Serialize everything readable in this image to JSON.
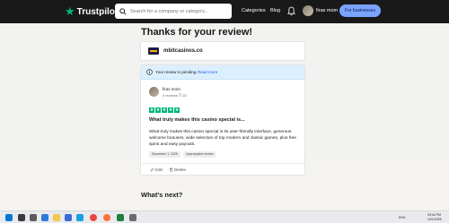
{
  "header": {
    "logo_text": "Trustpilot",
    "search_placeholder": "Search for a company or category...",
    "nav_categories": "Categories",
    "nav_blog": "Blog",
    "user_name": "firas mom",
    "business_button": "For businesses"
  },
  "main": {
    "page_title": "Thanks for your review!",
    "company_name": "mbitcasinos.co",
    "pending_text": "Your review is pending.",
    "read_more": "Read more",
    "reviewer_name": "firas mom",
    "review_count": "0 reviews",
    "country": "JO",
    "rating": 5,
    "review_title": "What truly makes this casino special is...",
    "review_body": "What truly makes this casino special is its user-friendly interface, generous welcome bonuses, wide selection of top modern and classic games, plus free spins and easy payouts.",
    "review_date": "December 1, 2025",
    "unprompted_badge": "Unprompted review",
    "edit_label": "Edit",
    "delete_label": "Delete",
    "whats_next": "What's next?"
  },
  "taskbar": {
    "lang": "ENG",
    "time": "03:44 PM",
    "date": "12/1/2025"
  },
  "colors": {
    "header_bg": "#191919",
    "brand_green": "#00b67a",
    "business_btn": "#7aa3ff",
    "pending_bg": "#dcefff"
  }
}
